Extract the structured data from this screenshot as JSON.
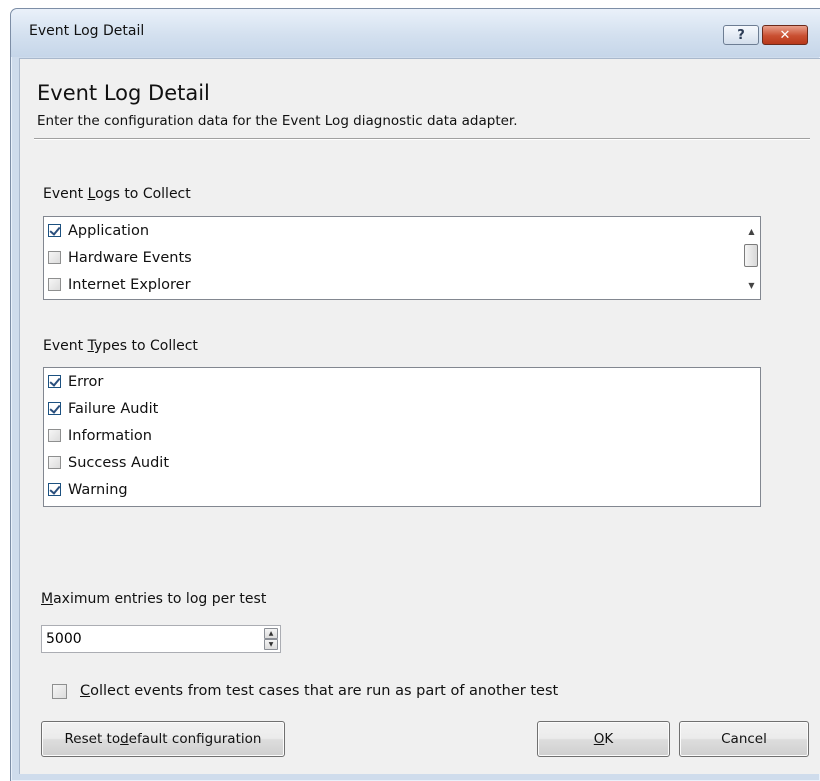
{
  "window": {
    "title": "Event Log Detail",
    "help_label": "?",
    "close_label": "✕"
  },
  "header": {
    "heading": "Event Log Detail",
    "subheading": "Enter the configuration data for the Event Log diagnostic data adapter."
  },
  "event_logs": {
    "label_pre": "Event ",
    "label_accel": "L",
    "label_post": "ogs to Collect",
    "items": [
      {
        "label": "Application",
        "checked": true
      },
      {
        "label": "Hardware Events",
        "checked": false
      },
      {
        "label": "Internet Explorer",
        "checked": false
      }
    ]
  },
  "event_types": {
    "label_pre": "Event ",
    "label_accel": "T",
    "label_post": "ypes to Collect",
    "items": [
      {
        "label": "Error",
        "checked": true
      },
      {
        "label": "Failure Audit",
        "checked": true
      },
      {
        "label": "Information",
        "checked": false
      },
      {
        "label": "Success Audit",
        "checked": false
      },
      {
        "label": "Warning",
        "checked": true
      }
    ]
  },
  "max_entries": {
    "label_accel": "M",
    "label_post": "aximum entries to log per test",
    "value": "5000"
  },
  "collect_nested": {
    "label_accel": "C",
    "label_post": "ollect events from test cases that are run as part of another test",
    "checked": false
  },
  "buttons": {
    "reset_pre": "Reset to ",
    "reset_accel": "d",
    "reset_post": "efault configuration",
    "ok_accel": "O",
    "ok_post": "K",
    "cancel": "Cancel"
  },
  "icons": {
    "scroll_up": "▲",
    "scroll_down": "▼",
    "spin_up": "▲",
    "spin_down": "▼"
  }
}
